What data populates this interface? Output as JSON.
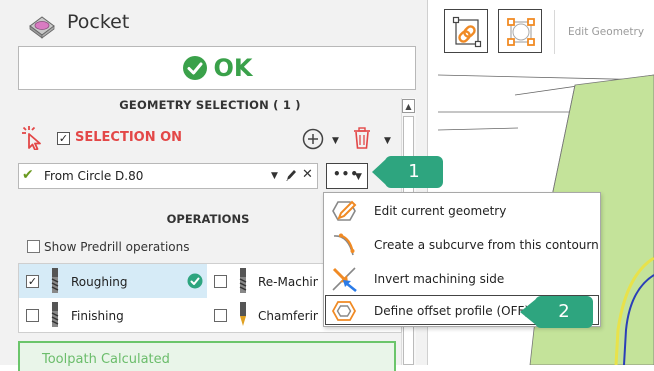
{
  "panel": {
    "title": "Pocket",
    "ok_label": "OK",
    "geometry_heading": "GEOMETRY SELECTION ( 1 )",
    "selection_label": "SELECTION ON",
    "selection_checked": true,
    "geometry_value": "From Circle D.80",
    "more_label": "•••",
    "operations_heading": "OPERATIONS",
    "predrill_label": "Show Predrill operations",
    "operations": [
      {
        "label": "Roughing",
        "checked": true,
        "calculated": true
      },
      {
        "label": "Re-Machinin",
        "checked": false
      },
      {
        "label": "Finishing",
        "checked": false
      },
      {
        "label": "Chamfering",
        "checked": false
      }
    ],
    "status_label": "Toolpath Calculated"
  },
  "toolbar": {
    "edit_geometry_label": "Edit Geometry"
  },
  "menu": {
    "items": [
      {
        "label": "Edit current geometry",
        "icon": "edit-geometry-icon"
      },
      {
        "label": "Create a subcurve from this contourn",
        "icon": "subcurve-icon"
      },
      {
        "label": "Invert machining side",
        "icon": "invert-side-icon"
      },
      {
        "label": "Define offset profile (OFF)",
        "icon": "offset-profile-icon"
      }
    ]
  },
  "callouts": [
    {
      "label": "1"
    },
    {
      "label": "2"
    }
  ],
  "colors": {
    "ok_green": "#3aa14a",
    "selection_red": "#e34747",
    "accent_orange": "#f08a24",
    "callout_green": "#2ea57f",
    "calculated_green": "#6bc56b"
  }
}
